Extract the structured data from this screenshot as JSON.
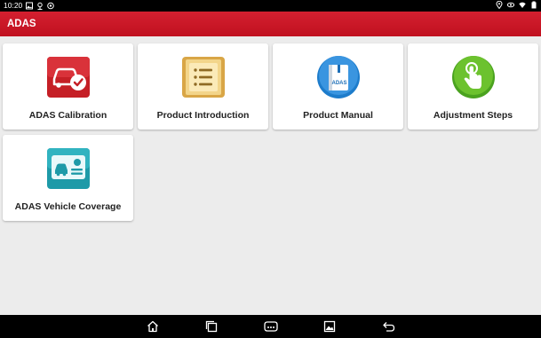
{
  "status_bar": {
    "time": "10:20",
    "left_icons": [
      "image-icon",
      "location-pin-icon",
      "settings-icon"
    ],
    "right_icons": [
      "location-icon",
      "eye-icon",
      "wifi-icon",
      "battery-icon"
    ]
  },
  "app_bar": {
    "title": "ADAS"
  },
  "cards": [
    {
      "label": "ADAS Calibration",
      "icon": "car-check-icon"
    },
    {
      "label": "Product Introduction",
      "icon": "list-document-icon"
    },
    {
      "label": "Product Manual",
      "icon": "manual-book-icon",
      "icon_text": "ADAS"
    },
    {
      "label": "Adjustment Steps",
      "icon": "tap-hand-icon"
    },
    {
      "label": "ADAS Vehicle Coverage",
      "icon": "vehicle-coverage-icon"
    }
  ],
  "nav_bar": {
    "buttons": [
      "home-icon",
      "recent-apps-icon",
      "vci-icon",
      "screenshot-icon",
      "back-icon"
    ]
  },
  "colors": {
    "app_bar": "#c8161f",
    "background": "#ececec",
    "card": "#ffffff"
  }
}
